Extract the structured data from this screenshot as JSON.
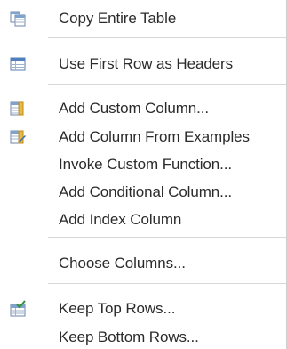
{
  "menu": {
    "items": [
      {
        "label": "Copy Entire Table",
        "icon": "copy-table-icon"
      },
      {
        "label": "Use First Row as Headers",
        "icon": "table-headers-icon"
      },
      {
        "label": "Add Custom Column...",
        "icon": "custom-column-icon"
      },
      {
        "label": "Add Column From Examples",
        "icon": "column-from-examples-icon"
      },
      {
        "label": "Invoke Custom Function..."
      },
      {
        "label": "Add Conditional Column..."
      },
      {
        "label": "Add Index Column"
      },
      {
        "label": "Choose Columns..."
      },
      {
        "label": "Keep Top Rows...",
        "icon": "keep-rows-icon"
      },
      {
        "label": "Keep Bottom Rows..."
      }
    ]
  },
  "colors": {
    "text": "#2b2b2b",
    "separator": "#d8d8d8",
    "icon_blue": "#2f6fb3",
    "icon_gold": "#d9a31a",
    "icon_green": "#3a8f3a"
  }
}
